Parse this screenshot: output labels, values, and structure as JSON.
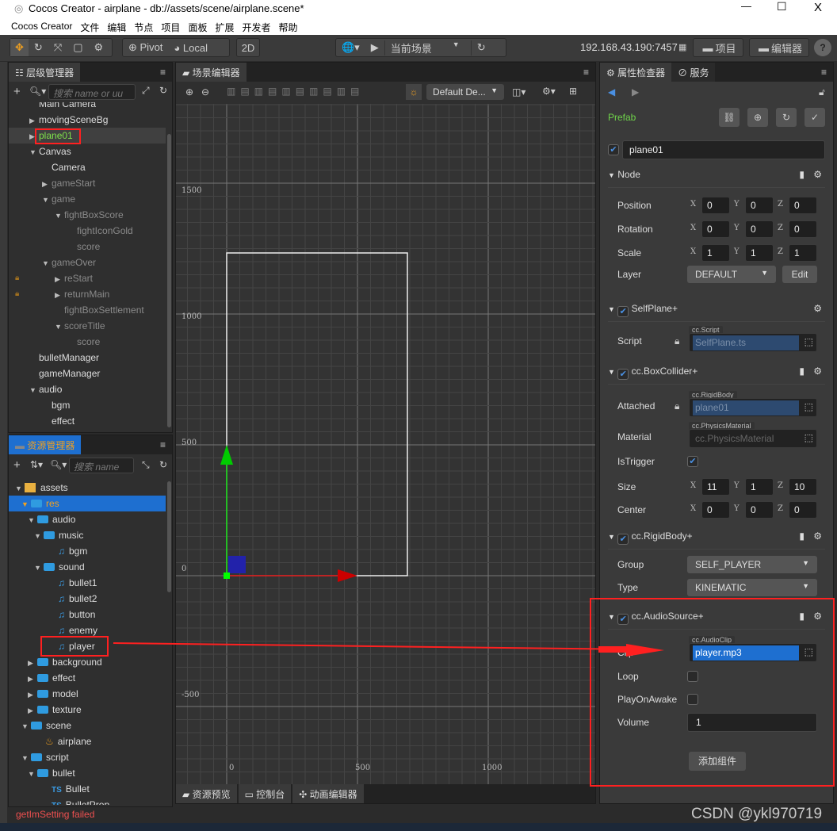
{
  "window": {
    "title": "Cocos Creator - airplane - db://assets/scene/airplane.scene*",
    "minimize": "—",
    "maximize": "☐",
    "close": "X"
  },
  "menu": [
    "Cocos Creator",
    "文件",
    "编辑",
    "节点",
    "项目",
    "面板",
    "扩展",
    "开发者",
    "帮助"
  ],
  "toolbar": {
    "pivot": "Pivot",
    "local": "Local",
    "mode2d": "2D",
    "scene_select": "当前场景",
    "ip": "192.168.43.190:7457",
    "project": "项目",
    "editor": "编辑器",
    "help": "?"
  },
  "hierarchy": {
    "title": "层级管理器",
    "search_placeholder": "搜索 name or uu",
    "items": [
      {
        "label": "Main Camera",
        "depth": 1,
        "arrow": "",
        "dim": false
      },
      {
        "label": "movingSceneBg",
        "depth": 1,
        "arrow": "▶",
        "dim": false
      },
      {
        "label": "plane01",
        "depth": 1,
        "arrow": "▶",
        "dim": false,
        "selected": true
      },
      {
        "label": "Canvas",
        "depth": 1,
        "arrow": "▼",
        "dim": false
      },
      {
        "label": "Camera",
        "depth": 2,
        "arrow": "",
        "dim": false
      },
      {
        "label": "gameStart",
        "depth": 2,
        "arrow": "▶",
        "dim": true
      },
      {
        "label": "game",
        "depth": 2,
        "arrow": "▼",
        "dim": true
      },
      {
        "label": "fightBoxScore",
        "depth": 3,
        "arrow": "▼",
        "dim": true
      },
      {
        "label": "fightIconGold",
        "depth": 4,
        "arrow": "",
        "dim": true
      },
      {
        "label": "score",
        "depth": 4,
        "arrow": "",
        "dim": true
      },
      {
        "label": "gameOver",
        "depth": 2,
        "arrow": "▼",
        "dim": true
      },
      {
        "label": "reStart",
        "depth": 3,
        "arrow": "▶",
        "dim": true,
        "locked": true
      },
      {
        "label": "returnMain",
        "depth": 3,
        "arrow": "▶",
        "dim": true,
        "locked": true
      },
      {
        "label": "fightBoxSettlement",
        "depth": 3,
        "arrow": "",
        "dim": true
      },
      {
        "label": "scoreTitle",
        "depth": 3,
        "arrow": "▼",
        "dim": true
      },
      {
        "label": "score",
        "depth": 4,
        "arrow": "",
        "dim": true
      },
      {
        "label": "bulletManager",
        "depth": 1,
        "arrow": "",
        "dim": false
      },
      {
        "label": "gameManager",
        "depth": 1,
        "arrow": "",
        "dim": false
      },
      {
        "label": "audio",
        "depth": 1,
        "arrow": "▼",
        "dim": false
      },
      {
        "label": "bgm",
        "depth": 2,
        "arrow": "",
        "dim": false
      },
      {
        "label": "effect",
        "depth": 2,
        "arrow": "",
        "dim": false
      }
    ]
  },
  "assets": {
    "title": "资源管理器",
    "search_placeholder": "搜索 name",
    "items": [
      {
        "label": "assets",
        "depth": 0,
        "arrow": "▼",
        "icon": "db"
      },
      {
        "label": "res",
        "depth": 1,
        "arrow": "▼",
        "icon": "folder",
        "selected": true
      },
      {
        "label": "audio",
        "depth": 2,
        "arrow": "▼",
        "icon": "folder"
      },
      {
        "label": "music",
        "depth": 3,
        "arrow": "▼",
        "icon": "folder"
      },
      {
        "label": "bgm",
        "depth": 4,
        "arrow": "",
        "icon": "audio"
      },
      {
        "label": "sound",
        "depth": 3,
        "arrow": "▼",
        "icon": "folder"
      },
      {
        "label": "bullet1",
        "depth": 4,
        "arrow": "",
        "icon": "audio"
      },
      {
        "label": "bullet2",
        "depth": 4,
        "arrow": "",
        "icon": "audio"
      },
      {
        "label": "button",
        "depth": 4,
        "arrow": "",
        "icon": "audio"
      },
      {
        "label": "enemy",
        "depth": 4,
        "arrow": "",
        "icon": "audio"
      },
      {
        "label": "player",
        "depth": 4,
        "arrow": "",
        "icon": "audio",
        "highlight": true
      },
      {
        "label": "background",
        "depth": 2,
        "arrow": "▶",
        "icon": "folder"
      },
      {
        "label": "effect",
        "depth": 2,
        "arrow": "▶",
        "icon": "folder"
      },
      {
        "label": "model",
        "depth": 2,
        "arrow": "▶",
        "icon": "folder"
      },
      {
        "label": "texture",
        "depth": 2,
        "arrow": "▶",
        "icon": "folder"
      },
      {
        "label": "scene",
        "depth": 1,
        "arrow": "▼",
        "icon": "folder"
      },
      {
        "label": "airplane",
        "depth": 2,
        "arrow": "",
        "icon": "scene"
      },
      {
        "label": "script",
        "depth": 1,
        "arrow": "▼",
        "icon": "folder"
      },
      {
        "label": "bullet",
        "depth": 2,
        "arrow": "▼",
        "icon": "folder"
      },
      {
        "label": "Bullet",
        "depth": 3,
        "arrow": "",
        "icon": "ts"
      },
      {
        "label": "BulletProp",
        "depth": 3,
        "arrow": "",
        "icon": "ts"
      }
    ],
    "status": "getImSetting failed"
  },
  "scene": {
    "title": "场景编辑器",
    "camera_select": "Default De...",
    "axis_y": [
      "1500",
      "1000",
      "500",
      "0",
      "-500"
    ],
    "axis_x": [
      "0",
      "500",
      "1000"
    ],
    "bottom_tabs": [
      "资源预览",
      "控制台",
      "动画编辑器"
    ]
  },
  "inspector": {
    "title": "属性检查器",
    "tab2": "服务",
    "prefab": "Prefab",
    "node_name": "plane01",
    "node": {
      "title": "Node",
      "position": {
        "label": "Position",
        "x": "0",
        "y": "0",
        "z": "0"
      },
      "rotation": {
        "label": "Rotation",
        "x": "0",
        "y": "0",
        "z": "0"
      },
      "scale": {
        "label": "Scale",
        "x": "1",
        "y": "1",
        "z": "1"
      },
      "layer": {
        "label": "Layer",
        "value": "DEFAULT",
        "edit": "Edit"
      }
    },
    "selfplane": {
      "title": "SelfPlane+",
      "script_label": "Script",
      "type": "cc.Script",
      "value": "SelfPlane.ts"
    },
    "boxcollider": {
      "title": "cc.BoxCollider+",
      "attached_label": "Attached",
      "attached_type": "cc.RigidBody",
      "attached": "plane01",
      "material_label": "Material",
      "material_type": "cc.PhysicsMaterial",
      "material": "cc.PhysicsMaterial",
      "istrigger": "IsTrigger",
      "size": {
        "label": "Size",
        "x": "11",
        "y": "1",
        "z": "10"
      },
      "center": {
        "label": "Center",
        "x": "0",
        "y": "0",
        "z": "0"
      }
    },
    "rigidbody": {
      "title": "cc.RigidBody+",
      "group_label": "Group",
      "group": "SELF_PLAYER",
      "type_label": "Type",
      "type": "KINEMATIC"
    },
    "audiosource": {
      "title": "cc.AudioSource+",
      "clip_label": "Clip",
      "clip_type": "cc.AudioClip",
      "clip": "player.mp3",
      "loop": "Loop",
      "playonawake": "PlayOnAwake",
      "volume_label": "Volume",
      "volume": "1"
    },
    "add_component": "添加组件"
  },
  "watermark": "CSDN @ykl970719",
  "colors": {
    "accent": "#1e6fd0",
    "highlight": "#ff2020",
    "selected_node": "#7ee04a",
    "prefab": "#6fd34a"
  }
}
